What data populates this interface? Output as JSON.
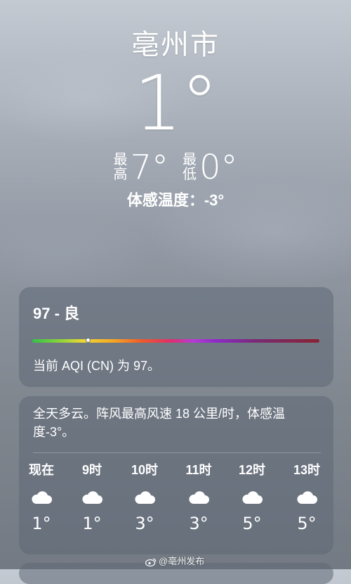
{
  "location": {
    "city": "亳州市",
    "current_temp": "1°",
    "high_label": [
      "最",
      "高"
    ],
    "high_temp": "7°",
    "low_label": [
      "最",
      "低"
    ],
    "low_temp": "0°",
    "feels_like": "体感温度：-3°"
  },
  "aqi": {
    "title": "97 - 良",
    "description": "当前 AQI (CN) 为 97。",
    "value": 97,
    "indicator_fraction": 0.195
  },
  "forecast": {
    "summary": "全天多云。阵风最高风速 18 公里/时，体感温度-3°。",
    "hours": [
      {
        "label": "现在",
        "icon": "cloud-icon",
        "temp": "1°"
      },
      {
        "label": "9时",
        "icon": "cloud-icon",
        "temp": "1°"
      },
      {
        "label": "10时",
        "icon": "cloud-icon",
        "temp": "3°"
      },
      {
        "label": "11时",
        "icon": "cloud-icon",
        "temp": "3°"
      },
      {
        "label": "12时",
        "icon": "cloud-icon",
        "temp": "5°"
      },
      {
        "label": "13时",
        "icon": "cloud-icon",
        "temp": "5°"
      }
    ]
  },
  "watermark": {
    "text": "@亳州发布",
    "icon": "weibo-icon"
  }
}
